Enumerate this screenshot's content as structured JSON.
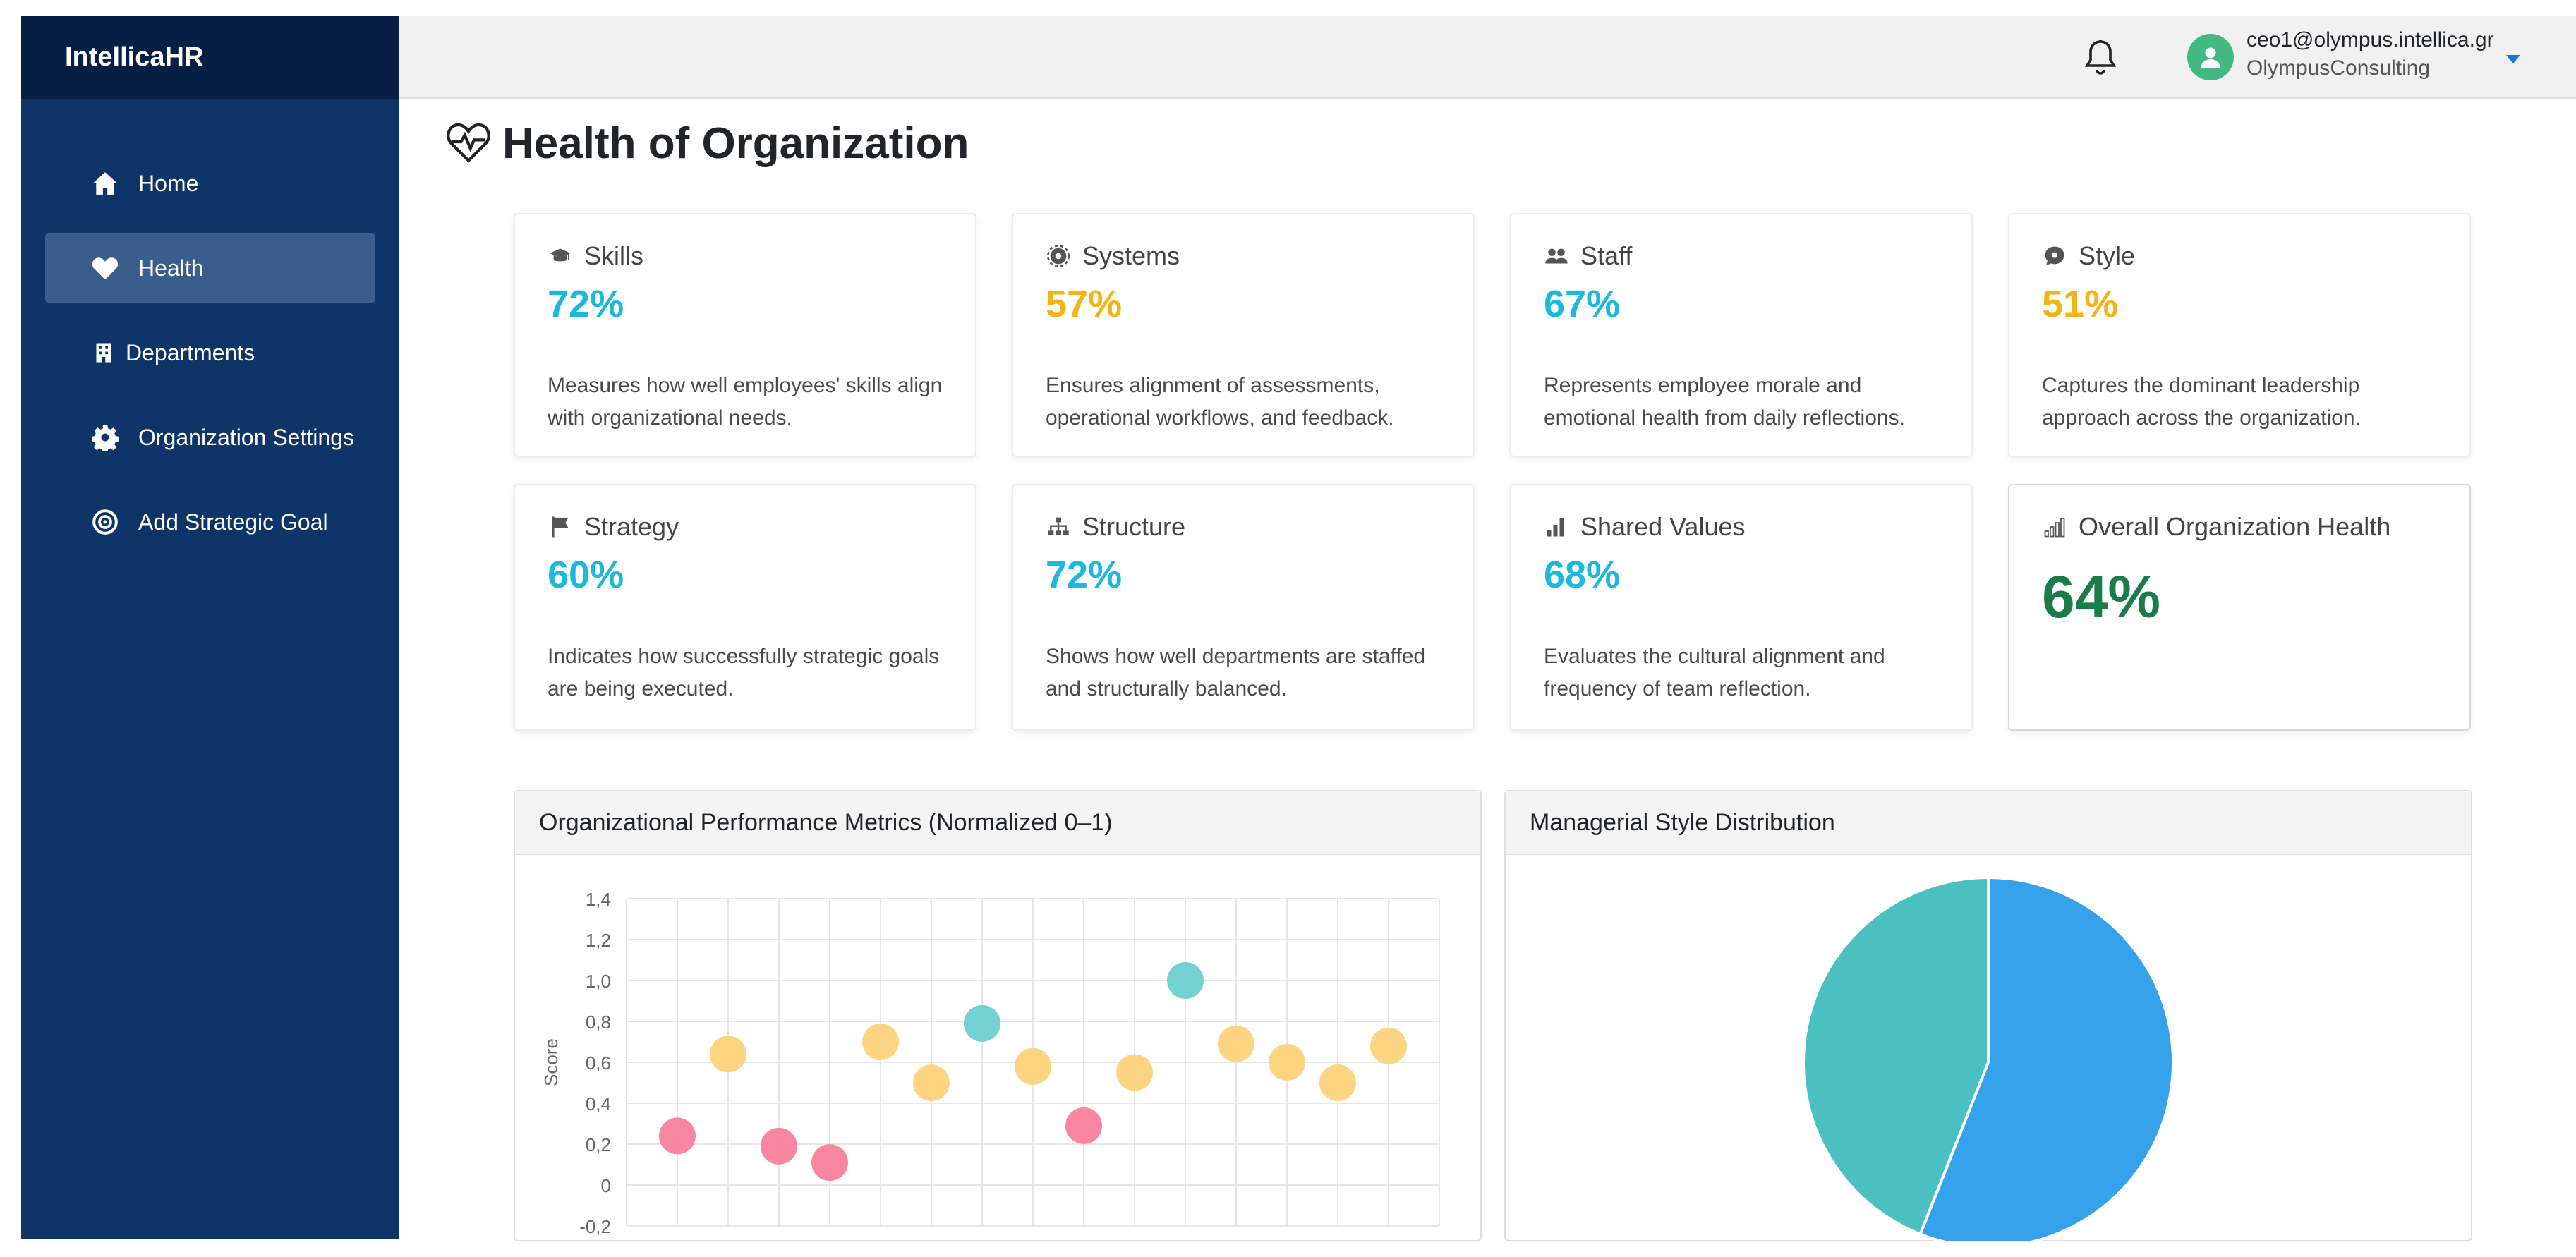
{
  "brand": "IntellicaHR",
  "sidebar": {
    "items": [
      {
        "label": "Home",
        "icon": "home-icon"
      },
      {
        "label": "Health",
        "icon": "heart-icon",
        "active": true
      },
      {
        "label": "Departments",
        "icon": "building-icon"
      },
      {
        "label": "Organization Settings",
        "icon": "gear-icon"
      },
      {
        "label": "Add Strategic Goal",
        "icon": "target-icon"
      }
    ]
  },
  "topbar": {
    "email": "ceo1@olympus.intellica.gr",
    "org": "OlympusConsulting"
  },
  "page": {
    "title": "Health of Organization"
  },
  "cards": [
    {
      "name": "Skills",
      "value": "72%",
      "color": "#1bb8df",
      "desc": "Measures how well employees' skills align with organizational needs.",
      "icon": "graduation-cap-icon"
    },
    {
      "name": "Systems",
      "value": "57%",
      "color": "#f5b416",
      "desc": "Ensures alignment of assessments, operational workflows, and feedback.",
      "icon": "cog-icon"
    },
    {
      "name": "Staff",
      "value": "67%",
      "color": "#1bb8df",
      "desc": "Represents employee morale and emotional health from daily reflections.",
      "icon": "users-icon"
    },
    {
      "name": "Style",
      "value": "51%",
      "color": "#f5b416",
      "desc": "Captures the dominant leadership approach across the organization.",
      "icon": "chat-icon"
    },
    {
      "name": "Strategy",
      "value": "60%",
      "color": "#1bb8df",
      "desc": "Indicates how successfully strategic goals are being executed.",
      "icon": "flag-icon"
    },
    {
      "name": "Structure",
      "value": "72%",
      "color": "#1bb8df",
      "desc": "Shows how well departments are staffed and structurally balanced.",
      "icon": "sitemap-icon"
    },
    {
      "name": "Shared Values",
      "value": "68%",
      "color": "#1bb8df",
      "desc": "Evaluates the cultural alignment and frequency of team reflection.",
      "icon": "bar-chart-icon"
    }
  ],
  "overall": {
    "name": "Overall Organization Health",
    "value": "64%",
    "color": "#1b7c4b",
    "icon": "signal-icon"
  },
  "panels": {
    "scatter_title": "Organizational Performance Metrics (Normalized 0–1)",
    "pie_title": "Managerial Style Distribution"
  },
  "chart_data": [
    {
      "type": "scatter",
      "title": "Organizational Performance Metrics (Normalized 0–1)",
      "ylabel": "Score",
      "ylim": [
        -0.2,
        1.4
      ],
      "ytick_labels": [
        "1,4",
        "1,2",
        "1,0",
        "0,8",
        "0,6",
        "0,4",
        "0,2",
        "0",
        "-0,2"
      ],
      "grid": true,
      "points": [
        {
          "x": 1,
          "y": 0.24,
          "color": "#f7809b"
        },
        {
          "x": 2,
          "y": 0.64,
          "color": "#fdd27a"
        },
        {
          "x": 3,
          "y": 0.19,
          "color": "#f7809b"
        },
        {
          "x": 4,
          "y": 0.11,
          "color": "#f7809b"
        },
        {
          "x": 5,
          "y": 0.7,
          "color": "#fdd27a"
        },
        {
          "x": 6,
          "y": 0.5,
          "color": "#fdd27a"
        },
        {
          "x": 7,
          "y": 0.79,
          "color": "#6ccfcf"
        },
        {
          "x": 8,
          "y": 0.58,
          "color": "#fdd27a"
        },
        {
          "x": 9,
          "y": 0.29,
          "color": "#f7809b"
        },
        {
          "x": 10,
          "y": 0.55,
          "color": "#fdd27a"
        },
        {
          "x": 11,
          "y": 1.0,
          "color": "#6ccfcf"
        },
        {
          "x": 12,
          "y": 0.69,
          "color": "#fdd27a"
        },
        {
          "x": 13,
          "y": 0.6,
          "color": "#fdd27a"
        },
        {
          "x": 14,
          "y": 0.5,
          "color": "#fdd27a"
        },
        {
          "x": 15,
          "y": 0.68,
          "color": "#fdd27a"
        }
      ]
    },
    {
      "type": "pie",
      "title": "Managerial Style Distribution",
      "slices": [
        {
          "value": 56,
          "color": "#36a2eb"
        },
        {
          "value": 44,
          "color": "#4bc0c0"
        }
      ]
    }
  ]
}
